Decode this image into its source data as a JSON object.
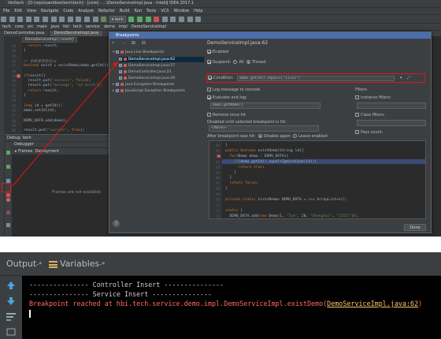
{
  "ide": {
    "title": "hbi/tech - [D:\\repo\\sandbox\\tech\\tech] - [core] - ...\\DemoServiceImpl.java - IntelliJ IDEA 2017.1",
    "menu": [
      "File",
      "Edit",
      "View",
      "Navigate",
      "Code",
      "Analyze",
      "Refactor",
      "Build",
      "Run",
      "Tools",
      "VCS",
      "Window",
      "Help"
    ],
    "run_config": "tech",
    "nav": [
      "tech",
      "core",
      "src",
      "main",
      "java",
      "hbi",
      "tech",
      "service",
      "demo",
      "impl",
      "DemoServiceImpl"
    ],
    "tabs": [
      "DemoController.java",
      "DemoServiceImpl.java"
    ],
    "editor_lines": [
      {
        "n": "43",
        "text": "  return result;"
      },
      {
        "n": "44",
        "text": "}"
      },
      {
        "n": "45",
        "text": ""
      },
      {
        "n": "46",
        "text": "// 判断是否存在id"
      },
      {
        "n": "47",
        "text": "boolean exist = existDemo(demo.getId());"
      },
      {
        "n": "48",
        "text": ""
      },
      {
        "n": "49",
        "text": "if(exist){"
      },
      {
        "n": "50",
        "text": "  result.put(\"success\", false);"
      },
      {
        "n": "51",
        "text": "  result.put(\"message\", \"id exist\");"
      },
      {
        "n": "52",
        "text": "  return result;"
      },
      {
        "n": "53",
        "text": "}"
      },
      {
        "n": "54",
        "text": ""
      },
      {
        "n": "55",
        "text": "long id = getId();"
      },
      {
        "n": "56",
        "text": "demo.setId(id);"
      },
      {
        "n": "57",
        "text": ""
      },
      {
        "n": "58",
        "text": "DEMO_DATA.add(demo);"
      },
      {
        "n": "59",
        "text": ""
      },
      {
        "n": "60",
        "text": "result.put(\"success\", true);"
      }
    ],
    "debug": {
      "header": "Debug",
      "tab_label": "tech",
      "debugger_tab": "Debugger",
      "frames_label": "Frames",
      "threads_label": "Deployment",
      "frames_empty": "Frames are not available"
    },
    "breadcrumb_method": "DemoServiceImpl | insert()"
  },
  "dialog": {
    "title": "Breakpoints",
    "toolbar": [
      "+",
      "−",
      "⊞",
      "⊟"
    ],
    "tree": [
      {
        "label": "Java Line Breakpoints",
        "level": 0,
        "checked": true,
        "group": true
      },
      {
        "label": "DemoServiceImpl.java:62",
        "level": 1,
        "checked": true,
        "selected": true
      },
      {
        "label": "DemoServiceImpl.java:57",
        "level": 1,
        "checked": true
      },
      {
        "label": "DemoController.java:23",
        "level": 1,
        "checked": true
      },
      {
        "label": "DemoServiceImpl.java:20",
        "level": 1,
        "checked": true
      },
      {
        "label": "Java Exception Breakpoints",
        "level": 0,
        "checked": true,
        "group": true
      },
      {
        "label": "JavaScript Exception Breakpoints",
        "level": 0,
        "checked": true,
        "group": true
      }
    ],
    "help": "?",
    "detail": {
      "title": "DemoServiceImpl.java:62",
      "enabled": "Enabled",
      "suspend": "Suspend:",
      "suspend_all": "All",
      "suspend_thread": "Thread",
      "condition_label": "Condition:",
      "condition_value": "demo.getId().equals(\"11111\")",
      "log_hit": "Log message to console",
      "log_eval": "Evaluate and log:",
      "log_eval_value": "demo.getName()",
      "remove_once": "Remove once hit",
      "disabled_until": "Disabled until selected breakpoint is hit:",
      "none_option": "<None>",
      "after_hit": "After breakpoint was hit:",
      "disable_again": "Disable again",
      "leave_enabled": "Leave enabled",
      "filters": "Filters",
      "instance_filters": "Instance filters:",
      "class_filters": "Class filters:",
      "pass_count": "Pass count:",
      "done": "Done"
    },
    "code_preview": [
      {
        "n": "60",
        "text": "}"
      },
      {
        "n": "61",
        "text": "public boolean existDemo(String id){"
      },
      {
        "n": "62",
        "text": "  for(Demo demo : DEMO_DATA){"
      },
      {
        "n": "63",
        "text": "    if(demo.getId().equalsIgnoreCase(id)){"
      },
      {
        "n": "64",
        "text": "      return true;"
      },
      {
        "n": "65",
        "text": "    }"
      },
      {
        "n": "66",
        "text": "  }"
      },
      {
        "n": "67",
        "text": "  return false;"
      },
      {
        "n": "68",
        "text": "}"
      },
      {
        "n": "69",
        "text": ""
      },
      {
        "n": "70",
        "text": "private static List<Demo> DEMO_DATA = new ArrayList<>();"
      },
      {
        "n": "71",
        "text": ""
      },
      {
        "n": "72",
        "text": "static {"
      },
      {
        "n": "73",
        "text": "  DEMO_DATA.add(new Demo(1, \"Tom\", 20, \"Shanghai\", \"11111\"));"
      }
    ]
  },
  "console": {
    "output_tab": "Output",
    "variables_tab": "Variables",
    "tab_suffix": "-*",
    "lines": [
      {
        "text": "--------------- Controller Insert ---------------",
        "style": "normal"
      },
      {
        "text": "--------------- Service Insert ---------------",
        "style": "normal"
      }
    ],
    "breakpoint_prefix": "Breakpoint reached at hbi.tech.service.demo.impl.DemoServiceImpl.existDemo(",
    "breakpoint_link": "DemoServiceImpl.java:62",
    "breakpoint_suffix": ")"
  },
  "colors": {
    "accent": "#4b6eaf",
    "highlight_red": "#e51414",
    "breakpoint": "#db5c5c",
    "console_error": "#ff6b68",
    "console_link": "#ffc66d"
  }
}
